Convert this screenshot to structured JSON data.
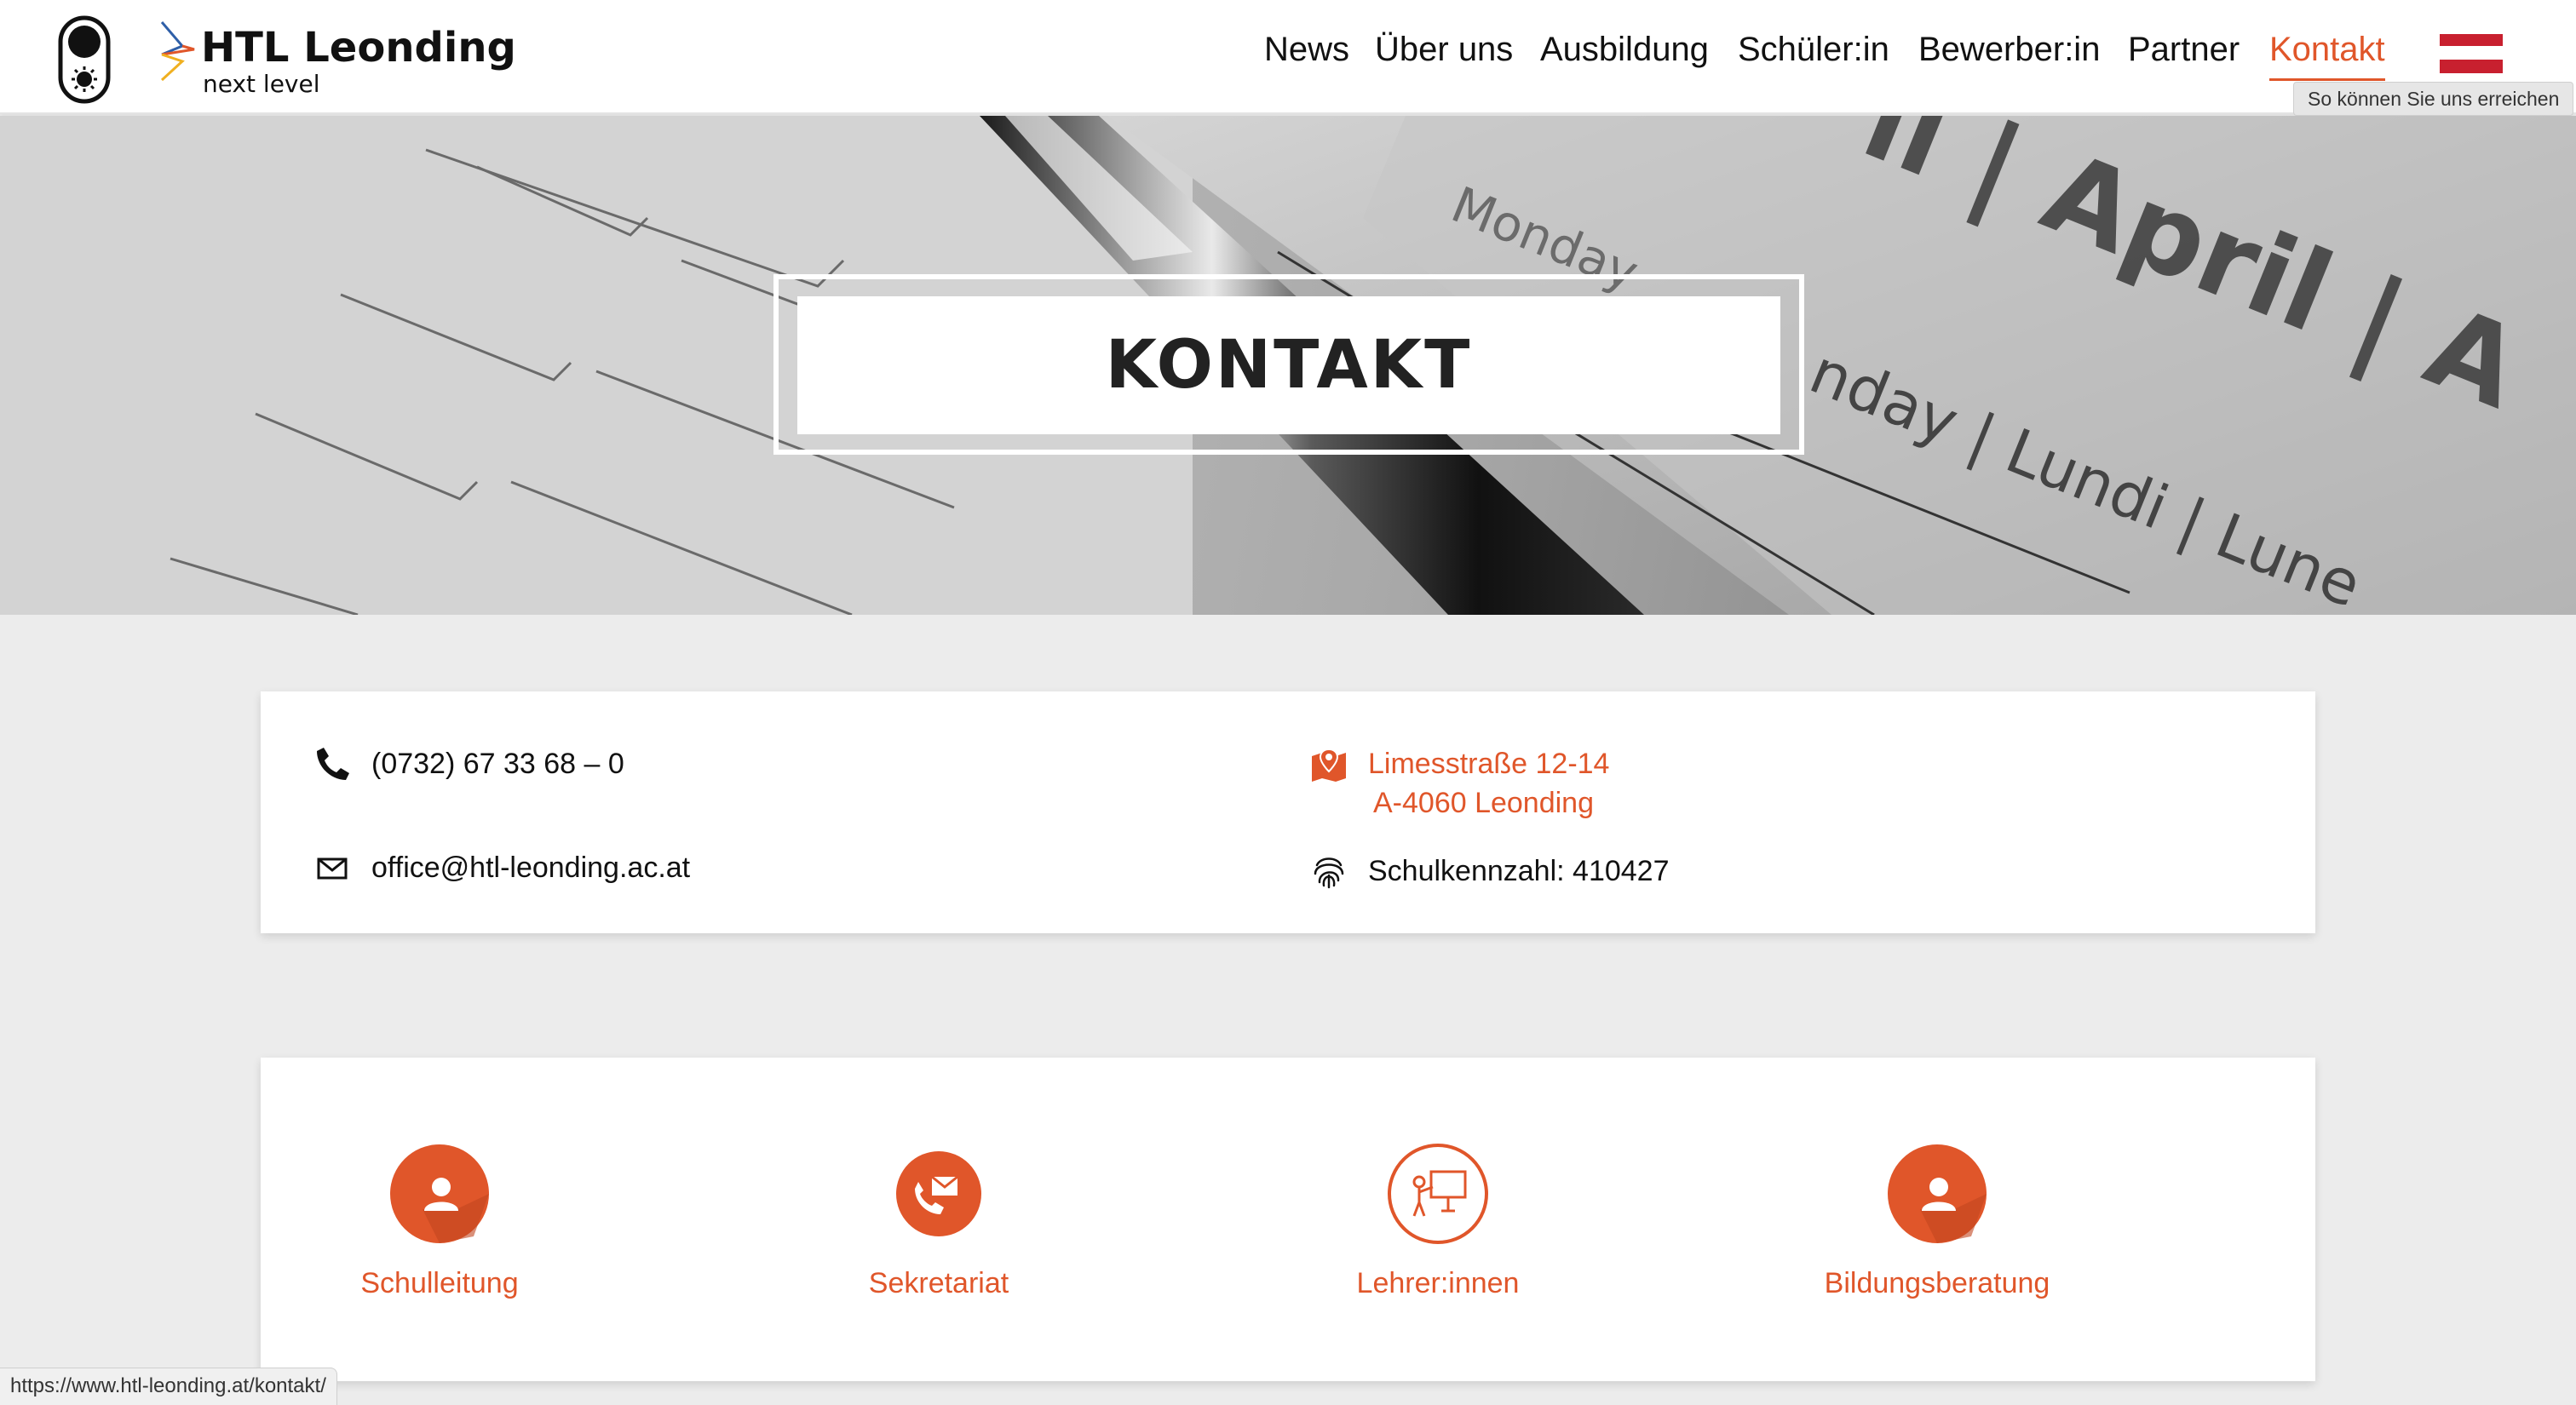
{
  "header": {
    "logo": {
      "name": "HTL Leonding",
      "tagline": "next level"
    },
    "nav": [
      {
        "label": "News"
      },
      {
        "label": "Über uns"
      },
      {
        "label": "Ausbildung"
      },
      {
        "label": "Schüler:in"
      },
      {
        "label": "Bewerber:in"
      },
      {
        "label": "Partner"
      },
      {
        "label": "Kontakt",
        "active": true
      }
    ],
    "tooltip": "So können Sie uns erreichen",
    "icons": {
      "toggle": "contrast-toggle-icon",
      "flag": "austria-flag-icon"
    }
  },
  "hero": {
    "title": "KONTAKT"
  },
  "contact": {
    "phone": "(0732) 67 33 68 – 0",
    "email": "office@htl-leonding.ac.at",
    "address_line1": "Limesstraße 12-14",
    "address_line2": "A-4060 Leonding",
    "school_code": "Schulkennzahl: 410427"
  },
  "departments": [
    {
      "label": "Schulleitung",
      "icon": "person-icon"
    },
    {
      "label": "Sekretariat",
      "icon": "phone-mail-icon"
    },
    {
      "label": "Lehrer:innen",
      "icon": "teacher-board-icon"
    },
    {
      "label": "Bildungsberatung",
      "icon": "person-icon"
    }
  ],
  "statusbar": {
    "url": "https://www.htl-leonding.at/kontakt/"
  },
  "colors": {
    "accent": "#e0562a",
    "background": "#ececec",
    "flag_red": "#c8202f"
  }
}
